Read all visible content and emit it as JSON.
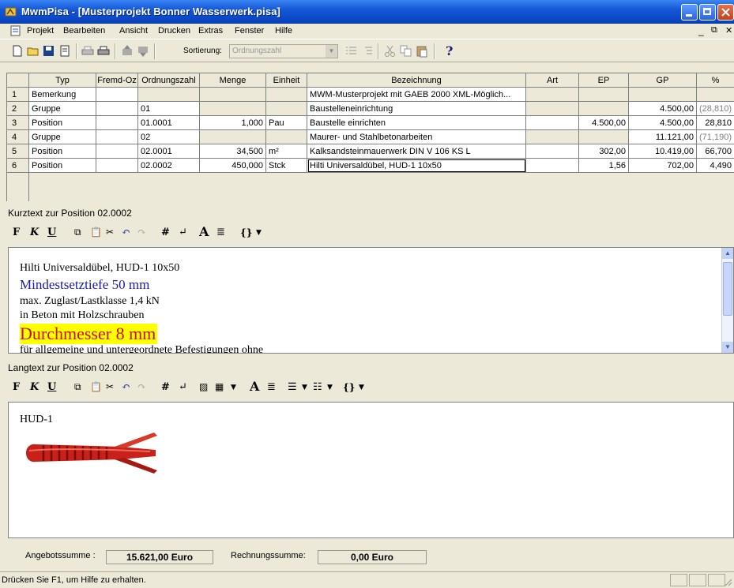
{
  "window": {
    "title": "MwmPisa - [Musterprojekt Bonner Wasserwerk.pisa]"
  },
  "menu": [
    "Projekt",
    "Bearbeiten",
    "Ansicht",
    "Drucken",
    "Extras",
    "Fenster",
    "Hilfe"
  ],
  "toolbar": {
    "sort_label": "Sortierung:",
    "sort_value": "Ordnungszahl"
  },
  "grid": {
    "columns": [
      "Typ",
      "Fremd-Oz",
      "Ordnungszahl",
      "Menge",
      "Einheit",
      "Bezeichnung",
      "Art",
      "EP",
      "GP",
      "%"
    ],
    "rows": [
      {
        "num": "1",
        "typ": "Bemerkung",
        "fremd": "",
        "oz": "",
        "menge": "",
        "einheit": "",
        "bez": "MWM-Musterprojekt mit GAEB 2000 XML-Möglich...",
        "art": "",
        "ep": "",
        "gp": "",
        "pct": ""
      },
      {
        "num": "2",
        "typ": "Gruppe",
        "fremd": "",
        "oz": "01",
        "menge": "",
        "einheit": "",
        "bez": "Baustelleneinrichtung",
        "art": "",
        "ep": "",
        "gp": "4.500,00",
        "pct": "(28,810)"
      },
      {
        "num": "3",
        "typ": "Position",
        "fremd": "",
        "oz": "01.0001",
        "menge": "1,000",
        "einheit": "Pau",
        "bez": "Baustelle einrichten",
        "art": "",
        "ep": "4.500,00",
        "gp": "4.500,00",
        "pct": "28,810"
      },
      {
        "num": "4",
        "typ": "Gruppe",
        "fremd": "",
        "oz": "02",
        "menge": "",
        "einheit": "",
        "bez": "Maurer- und Stahlbetonarbeiten",
        "art": "",
        "ep": "",
        "gp": "11.121,00",
        "pct": "(71,190)"
      },
      {
        "num": "5",
        "typ": "Position",
        "fremd": "",
        "oz": "02.0001",
        "menge": "34,500",
        "einheit": "m²",
        "bez": "Kalksandsteinmauerwerk DIN V 106 KS L",
        "art": "",
        "ep": "302,00",
        "gp": "10.419,00",
        "pct": "66,700"
      },
      {
        "num": "6",
        "typ": "Position",
        "fremd": "",
        "oz": "02.0002",
        "menge": "450,000",
        "einheit": "Stck",
        "bez": "Hilti Universaldübel, HUD-1 10x50",
        "art": "",
        "ep": "1,56",
        "gp": "702,00",
        "pct": "4,490"
      }
    ]
  },
  "kurztext": {
    "title": "Kurztext zur Position 02.0002",
    "lines": [
      "Hilti Universaldübel, HUD-1 10x50",
      "Mindestsetztiefe 50 mm",
      "max. Zuglast/Lastklasse 1,4 kN",
      "in Beton mit Holzschrauben",
      "Durchmesser 8 mm",
      "für allgemeine und untergeordnete Befestigungen ohne"
    ]
  },
  "langtext": {
    "title": "Langtext zur Position 02.0002",
    "text": "HUD-1"
  },
  "summary": {
    "angebot_label": "Angebotssumme :",
    "angebot_value": "15.621,00 Euro",
    "rechnung_label": "Rechnungssumme:",
    "rechnung_value": "0,00 Euro"
  },
  "status": {
    "text": "Drücken Sie F1, um Hilfe zu erhalten."
  },
  "colors": {
    "titlebar": "#0b46c4",
    "highlight": "#ffff00",
    "blue_text": "#1a1aa6",
    "dowel": "#c8201a"
  }
}
